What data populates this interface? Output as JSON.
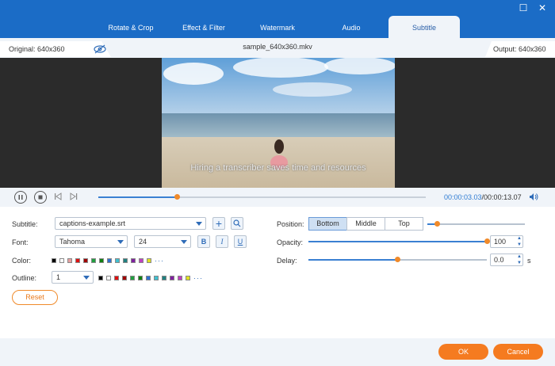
{
  "tabs": [
    "Rotate & Crop",
    "Effect & Filter",
    "Watermark",
    "Audio",
    "Subtitle"
  ],
  "active_tab": 4,
  "info": {
    "original": "Original: 640x360",
    "filename": "sample_640x360.mkv",
    "output": "Output: 640x360"
  },
  "video": {
    "subtitle_text": "Hiring a transcriber saves time and resources"
  },
  "playback": {
    "current": "00:00:03.03",
    "total": "/00:00:13.07",
    "progress": 0.24
  },
  "subtitle": {
    "label": "Subtitle:",
    "file": "captions-example.srt"
  },
  "font": {
    "label": "Font:",
    "family": "Tahoma",
    "size": "24",
    "bold": "B",
    "italic": "I",
    "underline": "U"
  },
  "color": {
    "label": "Color:",
    "swatches": [
      "#000000",
      "#ffffff",
      "#e8a0a0",
      "#e01010",
      "#a00000",
      "#20a040",
      "#108010",
      "#3070d0",
      "#40c0d0",
      "#208080",
      "#8020a0",
      "#c040c0",
      "#e0e020"
    ],
    "more": "···"
  },
  "outline": {
    "label": "Outline:",
    "value": "1",
    "swatches": [
      "#000000",
      "#ffffff",
      "#e01010",
      "#a00000",
      "#20a040",
      "#108010",
      "#3070d0",
      "#40c0d0",
      "#208080",
      "#8020a0",
      "#c040c0",
      "#e0e020"
    ],
    "more": "···"
  },
  "position": {
    "label": "Position:",
    "options": [
      "Bottom",
      "Middle",
      "Top"
    ],
    "selected": 0,
    "slider": 0.1
  },
  "opacity": {
    "label": "Opacity:",
    "value": "100",
    "level": 1.0
  },
  "delay": {
    "label": "Delay:",
    "value": "0.0",
    "unit": "s",
    "level": 0.5
  },
  "reset_label": "Reset",
  "footer": {
    "ok": "OK",
    "cancel": "Cancel"
  }
}
